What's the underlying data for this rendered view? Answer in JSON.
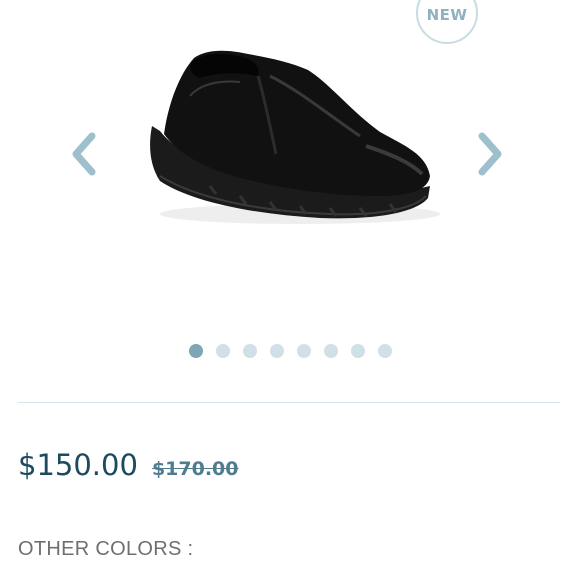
{
  "gallery": {
    "badge_label": "NEW",
    "image_alt": "black slip-on shoe",
    "slide_count": 8,
    "active_slide": 1,
    "icons": {
      "prev": "chevron-left-icon",
      "next": "chevron-right-icon"
    }
  },
  "pricing": {
    "current_price": "$150.00",
    "original_price": "$170.00"
  },
  "other_colors": {
    "label": "OTHER COLORS :"
  },
  "colors": {
    "accent": "#7ea6b5",
    "dot_inactive": "#cfe0e6",
    "price": "#1c4a5e",
    "divider": "#d7e4e9"
  }
}
